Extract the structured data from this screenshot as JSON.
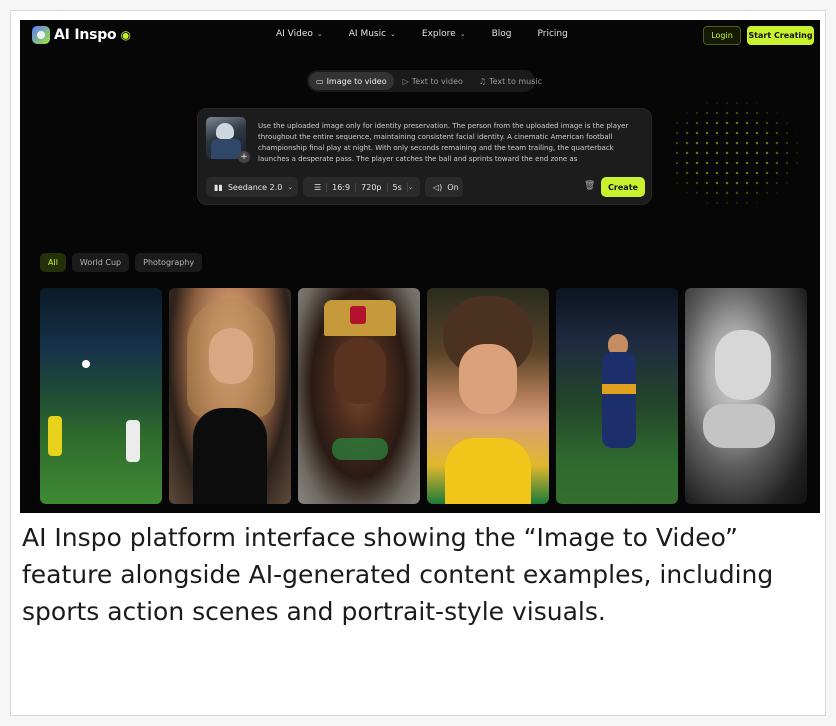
{
  "brand": {
    "name": "AI Inspo"
  },
  "nav": {
    "links": [
      {
        "label": "AI Video",
        "has_dropdown": true
      },
      {
        "label": "AI Music",
        "has_dropdown": true
      },
      {
        "label": "Explore",
        "has_dropdown": true
      },
      {
        "label": "Blog",
        "has_dropdown": false
      },
      {
        "label": "Pricing",
        "has_dropdown": false
      }
    ],
    "login_label": "Login",
    "start_label": "Start Creating"
  },
  "modes": [
    {
      "label": "Image to video",
      "icon": "image-video-icon",
      "active": true
    },
    {
      "label": "Text to video",
      "icon": "text-video-icon",
      "active": false
    },
    {
      "label": "Text to music",
      "icon": "music-icon",
      "active": false
    }
  ],
  "prompt": {
    "text": "Use the uploaded image only for identity preservation. The person from the uploaded image is the player throughout the entire sequence, maintaining consistent facial identity. A cinematic American football championship final play at night. With only seconds remaining and the team trailing, the quarterback launches a desperate pass. The player catches the ball and sprints toward the end zone as",
    "upload_plus": "+"
  },
  "controls": {
    "model": "Seedance 2.0",
    "ratio": "16:9",
    "resolution": "720p",
    "duration": "5s",
    "audio": "On",
    "create_label": "Create"
  },
  "filters": [
    {
      "label": "All",
      "active": true
    },
    {
      "label": "World Cup",
      "active": false
    },
    {
      "label": "Photography",
      "active": false
    }
  ],
  "caption": "AI Inspo platform interface showing the “Image to Video” feature alongside AI-generated content examples, including sports action scenes and portrait-style visuals.",
  "colors": {
    "accent": "#c7f22d",
    "background": "#060606",
    "card": "#1c1c1c"
  }
}
